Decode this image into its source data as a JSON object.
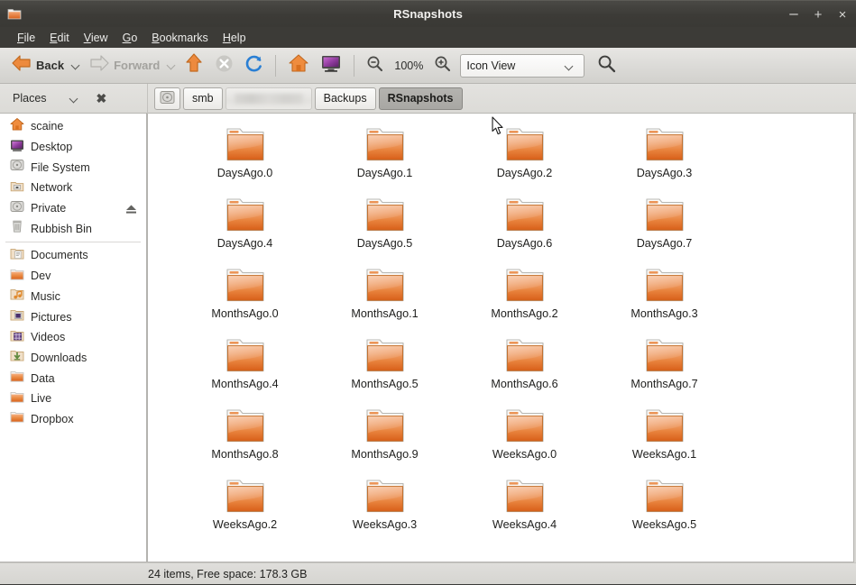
{
  "window": {
    "title": "RSnapshots",
    "icon": "folder-icon",
    "buttons": {
      "minimize": "–",
      "maximize": "+",
      "close": "×"
    }
  },
  "menubar": {
    "items": [
      {
        "label": "File",
        "mnemonic": "F"
      },
      {
        "label": "Edit",
        "mnemonic": "E"
      },
      {
        "label": "View",
        "mnemonic": "V"
      },
      {
        "label": "Go",
        "mnemonic": "G"
      },
      {
        "label": "Bookmarks",
        "mnemonic": "B"
      },
      {
        "label": "Help",
        "mnemonic": "H"
      }
    ]
  },
  "toolbar": {
    "back_label": "Back",
    "forward_label": "Forward",
    "up_icon": "arrow-up-icon",
    "stop_icon": "stop-icon",
    "reload_icon": "reload-icon",
    "home_icon": "home-icon",
    "computer_icon": "computer-icon",
    "zoom_out_icon": "zoom-out-icon",
    "zoom_level": "100%",
    "zoom_in_icon": "zoom-in-icon",
    "view_mode": "Icon View",
    "search_icon": "search-icon"
  },
  "pathbar": {
    "places_label": "Places",
    "places_chevron": "chevron-down-icon",
    "places_close": "✖",
    "crumbs": [
      {
        "label": "",
        "type": "disk-icon",
        "active": false
      },
      {
        "label": "smb",
        "type": "text",
        "active": false
      },
      {
        "label": "",
        "type": "redacted",
        "active": false
      },
      {
        "label": "Backups",
        "type": "text",
        "active": false
      },
      {
        "label": "RSnapshots",
        "type": "text",
        "active": true
      }
    ]
  },
  "sidebar": {
    "groups": [
      {
        "items": [
          {
            "label": "scaine",
            "icon": "home-icon",
            "eject": false
          },
          {
            "label": "Desktop",
            "icon": "desktop-icon",
            "eject": false
          },
          {
            "label": "File System",
            "icon": "disk-icon",
            "eject": false
          },
          {
            "label": "Network",
            "icon": "network-icon",
            "eject": false
          },
          {
            "label": "Private",
            "icon": "disk-icon",
            "eject": true
          },
          {
            "label": "Rubbish Bin",
            "icon": "trash-icon",
            "eject": false
          }
        ]
      },
      {
        "items": [
          {
            "label": "Documents",
            "icon": "documents-folder-icon",
            "eject": false
          },
          {
            "label": "Dev",
            "icon": "folder-icon",
            "eject": false
          },
          {
            "label": "Music",
            "icon": "music-folder-icon",
            "eject": false
          },
          {
            "label": "Pictures",
            "icon": "pictures-folder-icon",
            "eject": false
          },
          {
            "label": "Videos",
            "icon": "videos-folder-icon",
            "eject": false
          },
          {
            "label": "Downloads",
            "icon": "downloads-folder-icon",
            "eject": false
          },
          {
            "label": "Data",
            "icon": "folder-icon",
            "eject": false
          },
          {
            "label": "Live",
            "icon": "folder-icon",
            "eject": false
          },
          {
            "label": "Dropbox",
            "icon": "folder-icon",
            "eject": false
          }
        ]
      }
    ]
  },
  "files": [
    {
      "name": "DaysAgo.0",
      "icon": "folder-icon"
    },
    {
      "name": "DaysAgo.1",
      "icon": "folder-icon"
    },
    {
      "name": "DaysAgo.2",
      "icon": "folder-icon"
    },
    {
      "name": "DaysAgo.3",
      "icon": "folder-icon"
    },
    {
      "name": "DaysAgo.4",
      "icon": "folder-icon"
    },
    {
      "name": "DaysAgo.5",
      "icon": "folder-icon"
    },
    {
      "name": "DaysAgo.6",
      "icon": "folder-icon"
    },
    {
      "name": "DaysAgo.7",
      "icon": "folder-icon"
    },
    {
      "name": "MonthsAgo.0",
      "icon": "folder-icon"
    },
    {
      "name": "MonthsAgo.1",
      "icon": "folder-icon"
    },
    {
      "name": "MonthsAgo.2",
      "icon": "folder-icon"
    },
    {
      "name": "MonthsAgo.3",
      "icon": "folder-icon"
    },
    {
      "name": "MonthsAgo.4",
      "icon": "folder-icon"
    },
    {
      "name": "MonthsAgo.5",
      "icon": "folder-icon"
    },
    {
      "name": "MonthsAgo.6",
      "icon": "folder-icon"
    },
    {
      "name": "MonthsAgo.7",
      "icon": "folder-icon"
    },
    {
      "name": "MonthsAgo.8",
      "icon": "folder-icon"
    },
    {
      "name": "MonthsAgo.9",
      "icon": "folder-icon"
    },
    {
      "name": "WeeksAgo.0",
      "icon": "folder-icon"
    },
    {
      "name": "WeeksAgo.1",
      "icon": "folder-icon"
    },
    {
      "name": "WeeksAgo.2",
      "icon": "folder-icon"
    },
    {
      "name": "WeeksAgo.3",
      "icon": "folder-icon"
    },
    {
      "name": "WeeksAgo.4",
      "icon": "folder-icon"
    },
    {
      "name": "WeeksAgo.5",
      "icon": "folder-icon"
    }
  ],
  "statusbar": {
    "text": "24 items, Free space: 178.3 GB"
  },
  "colors": {
    "folder_orange_light": "#f5b186",
    "folder_orange": "#e8803a",
    "folder_orange_dark": "#d9641f",
    "titlebar": "#3c3b37",
    "toolbar": "#dcdbd8",
    "sidebar_bg": "#ffffff",
    "content_bg": "#ffffff",
    "accent_back_arrow": "#e8803a"
  }
}
